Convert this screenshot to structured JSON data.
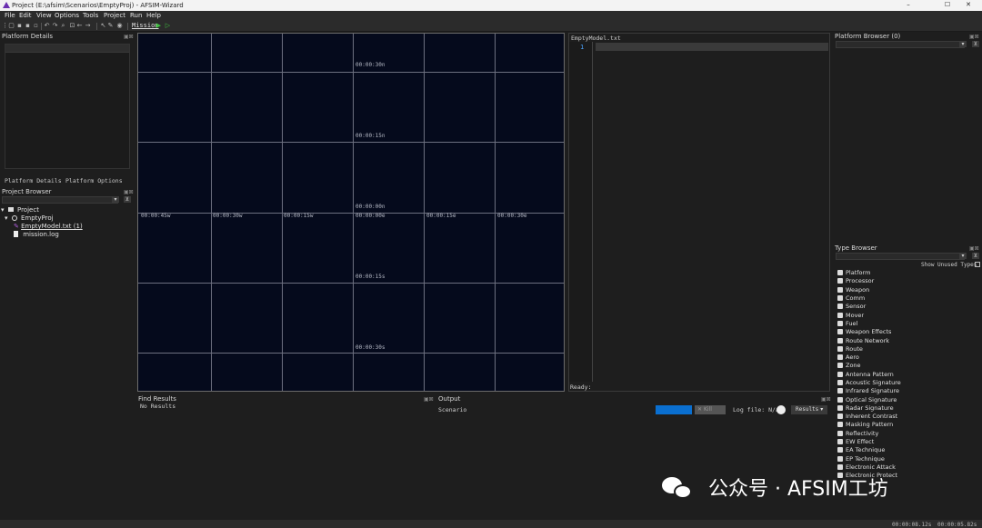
{
  "window": {
    "title": "Project (E:\\afsim\\Scenarios\\EmptyProj) - AFSIM-Wizard",
    "minimize": "–",
    "maximize": "☐",
    "close": "✕"
  },
  "menu": [
    "File",
    "Edit",
    "View",
    "Options",
    "Tools",
    "Project",
    "Run",
    "Help"
  ],
  "toolbar": {
    "mission_label": "Mission"
  },
  "platform_details": {
    "title": "Platform Details",
    "tabs": [
      "Platform Details",
      "Platform Options"
    ]
  },
  "project_browser": {
    "title": "Project Browser",
    "filter_button": "⊻",
    "tree": {
      "root": "Project",
      "project": "EmptyProj",
      "files": [
        "EmptyModel.txt (1)",
        "mission.log"
      ]
    }
  },
  "map": {
    "top_labels": [
      "00:00:30n",
      "00:00:15n",
      "00:00:00n"
    ],
    "bottom_labels": [
      "00:00:15s",
      "00:00:30s"
    ],
    "row_labels": [
      "00:00:45w",
      "00:00:30w",
      "00:00:15w",
      "00:00:00e",
      "00:00:15e",
      "00:00:30e"
    ]
  },
  "editor": {
    "tab": "EmptyModel.txt",
    "line_number": "1",
    "status": "Ready:"
  },
  "platform_browser": {
    "title": "Platform Browser (0)",
    "filter_button": "⊻"
  },
  "type_browser": {
    "title": "Type Browser",
    "filter_button": "⊻",
    "show_unused": "Show Unused Types",
    "items": [
      "Platform",
      "Processor",
      "Weapon",
      "Comm",
      "Sensor",
      "Mover",
      "Fuel",
      "Weapon Effects",
      "Route Network",
      "Route",
      "Aero",
      "Zone",
      "Antenna Pattern",
      "Acoustic Signature",
      "Infrared Signature",
      "Optical Signature",
      "Radar Signature",
      "Inherent Contrast",
      "Masking Pattern",
      "Reflectivity",
      "EW Effect",
      "EA Technique",
      "EP Technique",
      "Electronic Attack",
      "Electronic Protect"
    ]
  },
  "find_results": {
    "title": "Find Results",
    "message": "No Results"
  },
  "output": {
    "title": "Output",
    "scenario_label": "Scenario",
    "kill_button": "Kill",
    "log_file": "Log file: N/a",
    "results_button": "Results"
  },
  "status": {
    "time1": "00:00:08.12s",
    "time2": "00:00:05.82s"
  },
  "watermark": {
    "text": "公众号 · AFSIM工坊"
  },
  "colors": {
    "accent": "#0a6fd0",
    "map_bg": "#050a1c",
    "logo": "#6a2fb0"
  }
}
